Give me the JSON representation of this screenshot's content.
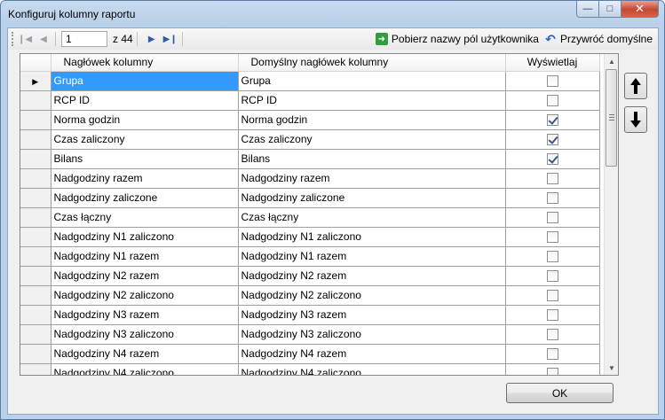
{
  "window": {
    "title": "Konfiguruj kolumny raportu"
  },
  "toolbar": {
    "current_position": "1",
    "count_label": "z 44",
    "fetch_user_fields_label": "Pobierz nazwy pól użytkownika",
    "restore_defaults_label": "Przywróć domyślne"
  },
  "grid": {
    "columns": [
      "Nagłówek kolumny",
      "Domyślny nagłówek kolumny",
      "Wyświetlaj"
    ],
    "rows": [
      {
        "header": "Grupa",
        "default_header": "Grupa",
        "visible": false,
        "selected": true
      },
      {
        "header": "RCP ID",
        "default_header": "RCP ID",
        "visible": false
      },
      {
        "header": "Norma godzin",
        "default_header": "Norma godzin",
        "visible": true
      },
      {
        "header": "Czas zaliczony",
        "default_header": "Czas zaliczony",
        "visible": true
      },
      {
        "header": "Bilans",
        "default_header": "Bilans",
        "visible": true
      },
      {
        "header": "Nadgodziny razem",
        "default_header": "Nadgodziny razem",
        "visible": false
      },
      {
        "header": "Nadgodziny zaliczone",
        "default_header": "Nadgodziny zaliczone",
        "visible": false
      },
      {
        "header": "Czas łączny",
        "default_header": "Czas łączny",
        "visible": false
      },
      {
        "header": "Nadgodziny N1 zaliczono",
        "default_header": "Nadgodziny N1 zaliczono",
        "visible": false
      },
      {
        "header": "Nadgodziny N1 razem",
        "default_header": "Nadgodziny N1 razem",
        "visible": false
      },
      {
        "header": "Nadgodziny N2 razem",
        "default_header": "Nadgodziny N2 razem",
        "visible": false
      },
      {
        "header": "Nadgodziny N2 zaliczono",
        "default_header": "Nadgodziny N2 zaliczono",
        "visible": false
      },
      {
        "header": "Nadgodziny N3 razem",
        "default_header": "Nadgodziny N3 razem",
        "visible": false
      },
      {
        "header": "Nadgodziny N3 zaliczono",
        "default_header": "Nadgodziny N3 zaliczono",
        "visible": false
      },
      {
        "header": "Nadgodziny N4 razem",
        "default_header": "Nadgodziny N4 razem",
        "visible": false
      },
      {
        "header": "Nadgodziny N4 zaliczono",
        "default_header": "Nadgodziny N4 zaliczono",
        "visible": false
      }
    ]
  },
  "buttons": {
    "ok_label": "OK"
  },
  "icons": {
    "move_up": "arrow-up-icon",
    "move_down": "arrow-down-icon",
    "fetch": "green-arrow-icon",
    "restore": "undo-icon"
  }
}
